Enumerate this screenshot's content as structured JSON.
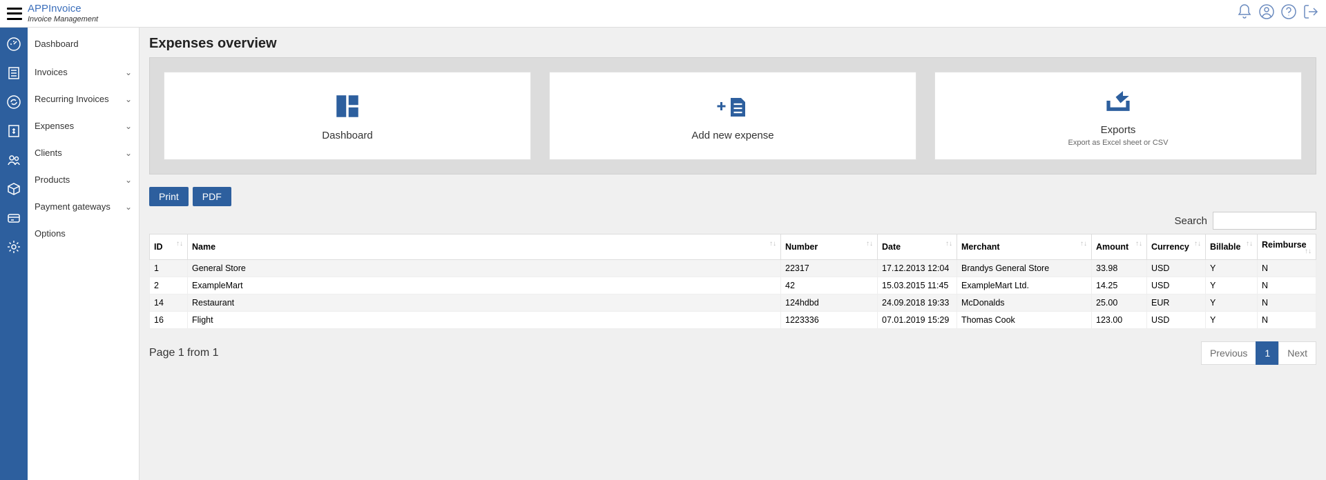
{
  "brand": {
    "title": "APPInvoice",
    "subtitle": "Invoice Management"
  },
  "sidebar": {
    "items": [
      {
        "label": "Dashboard",
        "chevron": false
      },
      {
        "label": "Invoices",
        "chevron": true
      },
      {
        "label": "Recurring Invoices",
        "chevron": true
      },
      {
        "label": "Expenses",
        "chevron": true
      },
      {
        "label": "Clients",
        "chevron": true
      },
      {
        "label": "Products",
        "chevron": true
      },
      {
        "label": "Payment gateways",
        "chevron": true
      },
      {
        "label": "Options",
        "chevron": false
      }
    ]
  },
  "page": {
    "title": "Expenses overview"
  },
  "cards": {
    "dashboard": {
      "label": "Dashboard"
    },
    "add_expense": {
      "label": "Add new expense"
    },
    "exports": {
      "label": "Exports",
      "sub": "Export as Excel sheet or CSV"
    }
  },
  "buttons": {
    "print": "Print",
    "pdf": "PDF"
  },
  "search": {
    "label": "Search"
  },
  "table": {
    "headers": {
      "id": "ID",
      "name": "Name",
      "number": "Number",
      "date": "Date",
      "merchant": "Merchant",
      "amount": "Amount",
      "currency": "Currency",
      "billable": "Billable",
      "reimburse": "Reimburse"
    },
    "rows": [
      {
        "id": "1",
        "name": "General Store",
        "number": "22317",
        "date": "17.12.2013 12:04",
        "merchant": "Brandys General Store",
        "amount": "33.98",
        "currency": "USD",
        "billable": "Y",
        "reimburse": "N"
      },
      {
        "id": "2",
        "name": "ExampleMart",
        "number": "42",
        "date": "15.03.2015 11:45",
        "merchant": "ExampleMart Ltd.",
        "amount": "14.25",
        "currency": "USD",
        "billable": "Y",
        "reimburse": "N"
      },
      {
        "id": "14",
        "name": "Restaurant",
        "number": "124hdbd",
        "date": "24.09.2018 19:33",
        "merchant": "McDonalds",
        "amount": "25.00",
        "currency": "EUR",
        "billable": "Y",
        "reimburse": "N"
      },
      {
        "id": "16",
        "name": "Flight",
        "number": "1223336",
        "date": "07.01.2019 15:29",
        "merchant": "Thomas Cook",
        "amount": "123.00",
        "currency": "USD",
        "billable": "Y",
        "reimburse": "N"
      }
    ]
  },
  "pagination": {
    "info": "Page 1 from 1",
    "previous": "Previous",
    "next": "Next",
    "current": "1"
  }
}
